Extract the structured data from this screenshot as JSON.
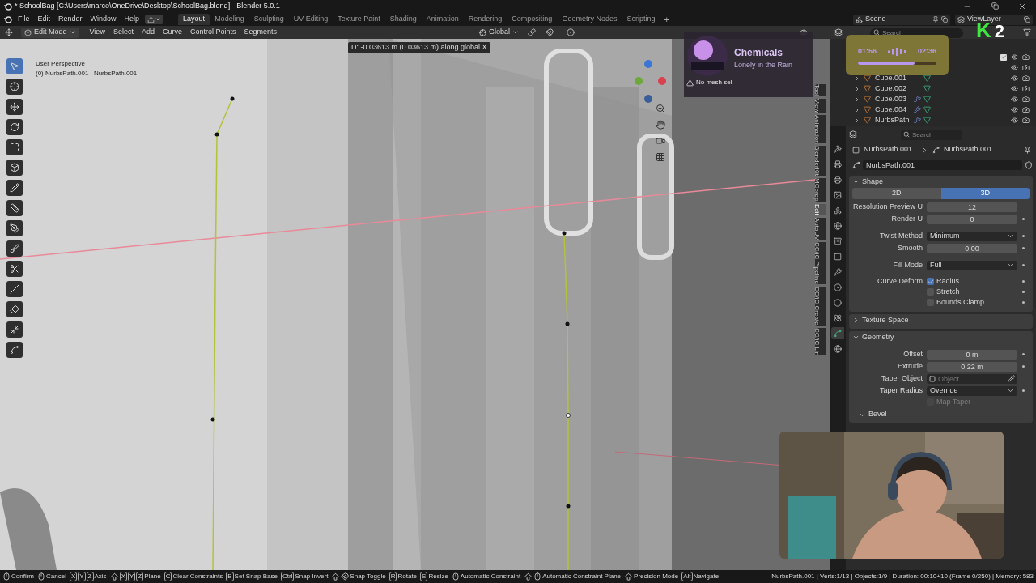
{
  "window": {
    "title": "* SchoolBag [C:\\Users\\marco\\OneDrive\\Desktop\\SchoolBag.blend] - Blender 5.0.1"
  },
  "menu": [
    "File",
    "Edit",
    "Render",
    "Window",
    "Help"
  ],
  "workspaces": [
    {
      "label": "Layout",
      "selected": true
    },
    {
      "label": "Modeling",
      "selected": false
    },
    {
      "label": "Sculpting",
      "selected": false
    },
    {
      "label": "UV Editing",
      "selected": false
    },
    {
      "label": "Texture Paint",
      "selected": false
    },
    {
      "label": "Shading",
      "selected": false
    },
    {
      "label": "Animation",
      "selected": false
    },
    {
      "label": "Rendering",
      "selected": false
    },
    {
      "label": "Compositing",
      "selected": false
    },
    {
      "label": "Geometry Nodes",
      "selected": false
    },
    {
      "label": "Scripting",
      "selected": false
    }
  ],
  "add_workspace": "+",
  "scene": "Scene",
  "view_layer": "ViewLayer",
  "viewport": {
    "mode": "Edit Mode",
    "menus": [
      "View",
      "Select",
      "Add",
      "Curve",
      "Control Points",
      "Segments"
    ],
    "orientation": "Global",
    "view_name": "User Perspective",
    "object_info": "(0) NurbsPath.001 | NurbsPath.001",
    "transform_info": "D: -0.03613 m (0.03613 m) along global X",
    "warning": "No mesh sel",
    "tools": [
      {
        "selected": true
      },
      {
        "selected": false
      },
      {
        "selected": false
      },
      {
        "selected": false
      },
      {
        "selected": false
      },
      {
        "selected": false
      },
      {
        "selected": false
      },
      {
        "selected": false
      },
      {
        "selected": false
      },
      {
        "selected": false
      },
      {
        "selected": false
      },
      {
        "selected": false
      },
      {
        "selected": false
      },
      {
        "selected": false
      },
      {
        "selected": false
      }
    ],
    "side_tabs": [
      {
        "label": "Tool",
        "selected": false
      },
      {
        "label": "View",
        "selected": false
      },
      {
        "label": "Animation",
        "selected": false
      },
      {
        "label": "BlenderKit",
        "selected": false
      },
      {
        "label": "MCprep",
        "selected": false
      },
      {
        "label": "Edit",
        "selected": true
      },
      {
        "label": "AutoUV",
        "selected": false
      },
      {
        "label": "CC/iC Pipeline",
        "selected": false
      },
      {
        "label": "CC/iC Create",
        "selected": false
      },
      {
        "label": "CC/iC Lin",
        "selected": false
      }
    ]
  },
  "outliner": {
    "search_placeholder": "Search",
    "items": [
      {
        "kind": "collection",
        "checked": true
      },
      {
        "kind": "row"
      },
      {
        "kind": "object",
        "name": "Cube.001",
        "modifier": false
      },
      {
        "kind": "object",
        "name": "Cube.002",
        "modifier": false
      },
      {
        "kind": "object",
        "name": "Cube.003",
        "modifier": true
      },
      {
        "kind": "object",
        "name": "Cube.004",
        "modifier": true
      },
      {
        "kind": "object",
        "name": "NurbsPath",
        "modifier": true
      }
    ]
  },
  "properties": {
    "search_placeholder": "Search",
    "tabs": [
      {
        "selected": false
      },
      {
        "selected": false
      },
      {
        "selected": false
      },
      {
        "selected": false
      },
      {
        "selected": false
      },
      {
        "selected": false
      },
      {
        "selected": false
      },
      {
        "selected": false
      },
      {
        "selected": false
      },
      {
        "selected": false
      },
      {
        "selected": false
      },
      {
        "selected": false
      },
      {
        "selected": true
      },
      {
        "selected": false
      }
    ],
    "breadcrumb": [
      "NurbsPath.001",
      "NurbsPath.001"
    ],
    "datablock": "NurbsPath.001",
    "panels": [
      {
        "title": "Shape",
        "expanded": true,
        "rows": [
          {
            "kind": "toggle",
            "options": [
              {
                "label": "2D",
                "selected": false
              },
              {
                "label": "3D",
                "selected": true
              }
            ]
          },
          {
            "kind": "number",
            "label": "Resolution Preview U",
            "value": "12",
            "animatable": false
          },
          {
            "kind": "number",
            "label": "Render U",
            "value": "0",
            "animatable": true
          },
          {
            "kind": "separator"
          },
          {
            "kind": "dropdown",
            "label": "Twist Method",
            "value": "Minimum",
            "animatable": true
          },
          {
            "kind": "number",
            "label": "Smooth",
            "value": "0.00",
            "animatable": true
          },
          {
            "kind": "separator"
          },
          {
            "kind": "dropdown",
            "label": "Fill Mode",
            "value": "Full",
            "animatable": true
          },
          {
            "kind": "separator"
          },
          {
            "kind": "checkbox",
            "label": "Curve Deform",
            "text": "Radius",
            "checked": true,
            "disabled": false,
            "animatable": true
          },
          {
            "kind": "checkbox",
            "text": "Stretch",
            "checked": false,
            "disabled": false,
            "animatable": true
          },
          {
            "kind": "checkbox",
            "text": "Bounds Clamp",
            "checked": false,
            "disabled": false,
            "animatable": true
          }
        ]
      },
      {
        "title": "Texture Space",
        "expanded": false
      },
      {
        "title": "Geometry",
        "expanded": true,
        "rows": [
          {
            "kind": "separator"
          },
          {
            "kind": "number",
            "label": "Offset",
            "value": "0 m",
            "animatable": true
          },
          {
            "kind": "number",
            "label": "Extrude",
            "value": "0.22 m",
            "animatable": true
          },
          {
            "kind": "object",
            "label": "Taper Object",
            "placeholder": "Object"
          },
          {
            "kind": "dropdown",
            "label": "Taper Radius",
            "value": "Override",
            "animatable": true
          },
          {
            "kind": "checkbox",
            "text": "Map Taper",
            "checked": false,
            "disabled": true,
            "animatable": false
          }
        ],
        "subpanels": [
          {
            "title": "Bevel",
            "expanded": true
          }
        ]
      }
    ]
  },
  "status_bar": {
    "hints": [
      {
        "keys": [
          {
            "kind": "mouse"
          }
        ],
        "label": "Confirm"
      },
      {
        "keys": [
          {
            "kind": "mouse"
          }
        ],
        "label": "Cancel"
      },
      {
        "keys": [
          {
            "kind": "key",
            "text": "X"
          },
          {
            "kind": "key",
            "text": "Y"
          },
          {
            "kind": "key",
            "text": "Z"
          }
        ],
        "label": "Axis"
      },
      {
        "keys": [
          {
            "kind": "shift"
          },
          {
            "kind": "key",
            "text": "X"
          },
          {
            "kind": "key",
            "text": "Y"
          },
          {
            "kind": "key",
            "text": "Z"
          }
        ],
        "label": "Plane"
      },
      {
        "keys": [
          {
            "kind": "key",
            "text": "C"
          }
        ],
        "label": "Clear Constraints"
      },
      {
        "keys": [
          {
            "kind": "key",
            "text": "B"
          }
        ],
        "label": "Set Snap Base"
      },
      {
        "keys": [
          {
            "kind": "key",
            "text": "Ctrl"
          }
        ],
        "label": "Snap Invert"
      },
      {
        "keys": [
          {
            "kind": "shift"
          },
          {
            "kind": "snap"
          }
        ],
        "label": "Snap Toggle"
      },
      {
        "keys": [
          {
            "kind": "key",
            "text": "R"
          }
        ],
        "label": "Rotate"
      },
      {
        "keys": [
          {
            "kind": "key",
            "text": "S"
          }
        ],
        "label": "Resize"
      },
      {
        "keys": [
          {
            "kind": "mouse"
          }
        ],
        "label": "Automatic Constraint"
      },
      {
        "keys": [
          {
            "kind": "shift"
          },
          {
            "kind": "mouse"
          }
        ],
        "label": "Automatic Constraint Plane"
      },
      {
        "keys": [
          {
            "kind": "shift"
          }
        ],
        "label": "Precision Mode"
      },
      {
        "keys": [
          {
            "kind": "key",
            "text": "Alt"
          }
        ],
        "label": "Navigate"
      }
    ],
    "stats": "NurbsPath.001 | Verts:1/13 | Objects:1/9 | Duration: 00:10+10 (Frame 0/250) | Memory: 583"
  },
  "music": {
    "elapsed": "01:56",
    "total": "02:36",
    "level": 0.72
  },
  "now_playing": {
    "title": "Chemicals",
    "artist": "Lonely in the Rain"
  },
  "logo": {
    "letter": "K",
    "digit": "2"
  }
}
